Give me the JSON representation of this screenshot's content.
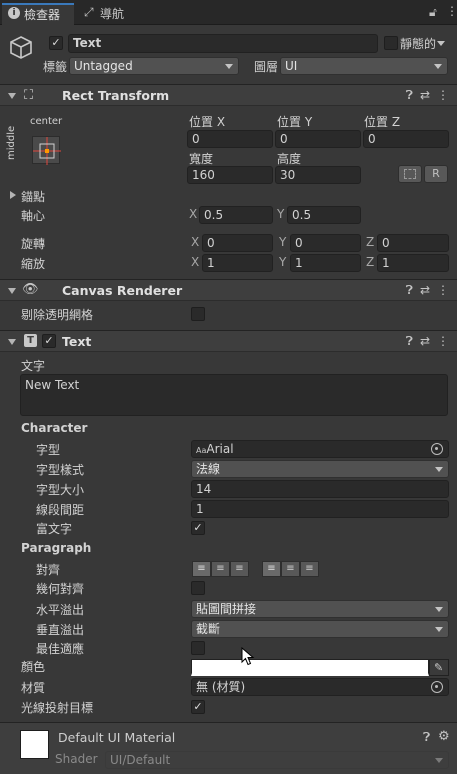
{
  "tabs": [
    {
      "label": "檢查器",
      "icon": "info-icon"
    },
    {
      "label": "導航",
      "icon": "navigation-icon"
    }
  ],
  "gameobject": {
    "name": "Text",
    "active": true,
    "static_label": "靜態的",
    "tag_label": "標籤",
    "tag_value": "Untagged",
    "layer_label": "圖層",
    "layer_value": "UI"
  },
  "rect_transform": {
    "title": "Rect Transform",
    "anchor_h": "center",
    "anchor_v": "middle",
    "pos_x_label": "位置 X",
    "pos_y_label": "位置 Y",
    "pos_z_label": "位置 Z",
    "pos_x": "0",
    "pos_y": "0",
    "pos_z": "0",
    "width_label": "寬度",
    "height_label": "高度",
    "width": "160",
    "height": "30",
    "r_button": "R",
    "anchors_label": "錨點",
    "pivot_label": "軸心",
    "pivot_x": "0.5",
    "pivot_y": "0.5",
    "rotation_label": "旋轉",
    "rot_x": "0",
    "rot_y": "0",
    "rot_z": "0",
    "scale_label": "縮放",
    "scale_x": "1",
    "scale_y": "1",
    "scale_z": "1",
    "axis_x": "X",
    "axis_y": "Y",
    "axis_z": "Z"
  },
  "canvas_renderer": {
    "title": "Canvas Renderer",
    "cull_label": "剔除透明網格"
  },
  "text_component": {
    "title": "Text",
    "text_label": "文字",
    "text_value": "New Text",
    "character_header": "Character",
    "font_label": "字型",
    "font_value": "Arial",
    "font_icon_text": "Aa",
    "font_style_label": "字型樣式",
    "font_style_value": "法線",
    "font_size_label": "字型大小",
    "font_size_value": "14",
    "line_spacing_label": "線段間距",
    "line_spacing_value": "1",
    "rich_text_label": "富文字",
    "paragraph_header": "Paragraph",
    "alignment_label": "對齊",
    "align_by_geometry_label": "幾何對齊",
    "horizontal_overflow_label": "水平溢出",
    "horizontal_overflow_value": "貼圖間拼接",
    "vertical_overflow_label": "垂直溢出",
    "vertical_overflow_value": "截斷",
    "best_fit_label": "最佳適應",
    "color_label": "顏色",
    "material_label": "材質",
    "material_value": "無 (材質)",
    "raycast_label": "光線投射目標"
  },
  "material_preview": {
    "name": "Default UI Material",
    "shader_label": "Shader",
    "shader_value": "UI/Default"
  },
  "colors": {
    "panel": "#383838",
    "header": "#3e3e3e",
    "field": "#2a2a2a",
    "anchor_red": "#e0463c",
    "anchor_orange": "#ff9a00"
  }
}
